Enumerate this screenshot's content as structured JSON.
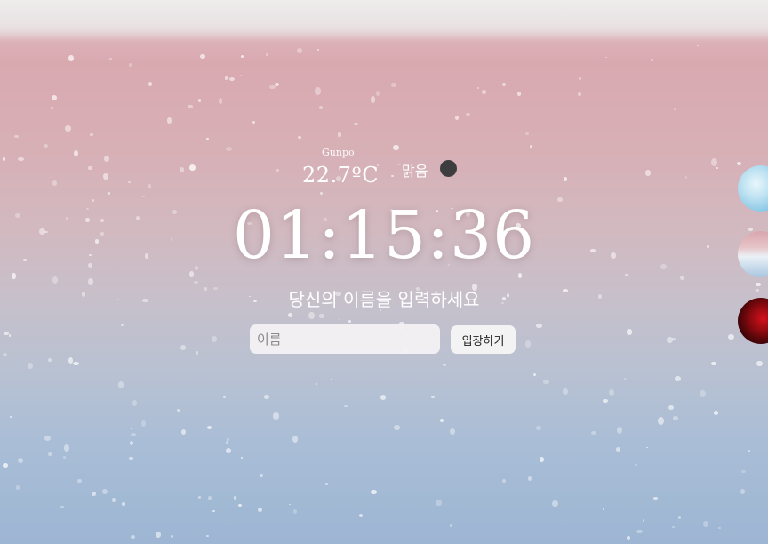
{
  "weather": {
    "city": "Gunpo",
    "temperature": "22.7ºC",
    "condition": "맑음",
    "icon": "dark-circle-weather-icon"
  },
  "clock": {
    "time": "01:15:36"
  },
  "greeting": {
    "prompt": "당신의 이름을 입력하세요",
    "input_placeholder": "이름",
    "input_value": "",
    "button_label": "입장하기"
  },
  "themes": [
    {
      "name": "theme-sky"
    },
    {
      "name": "theme-pink-sea"
    },
    {
      "name": "theme-red"
    }
  ],
  "colors": {
    "text": "#ffffff",
    "input_bg": "#f5f3f5",
    "icon_dark": "#3d3d3f"
  }
}
